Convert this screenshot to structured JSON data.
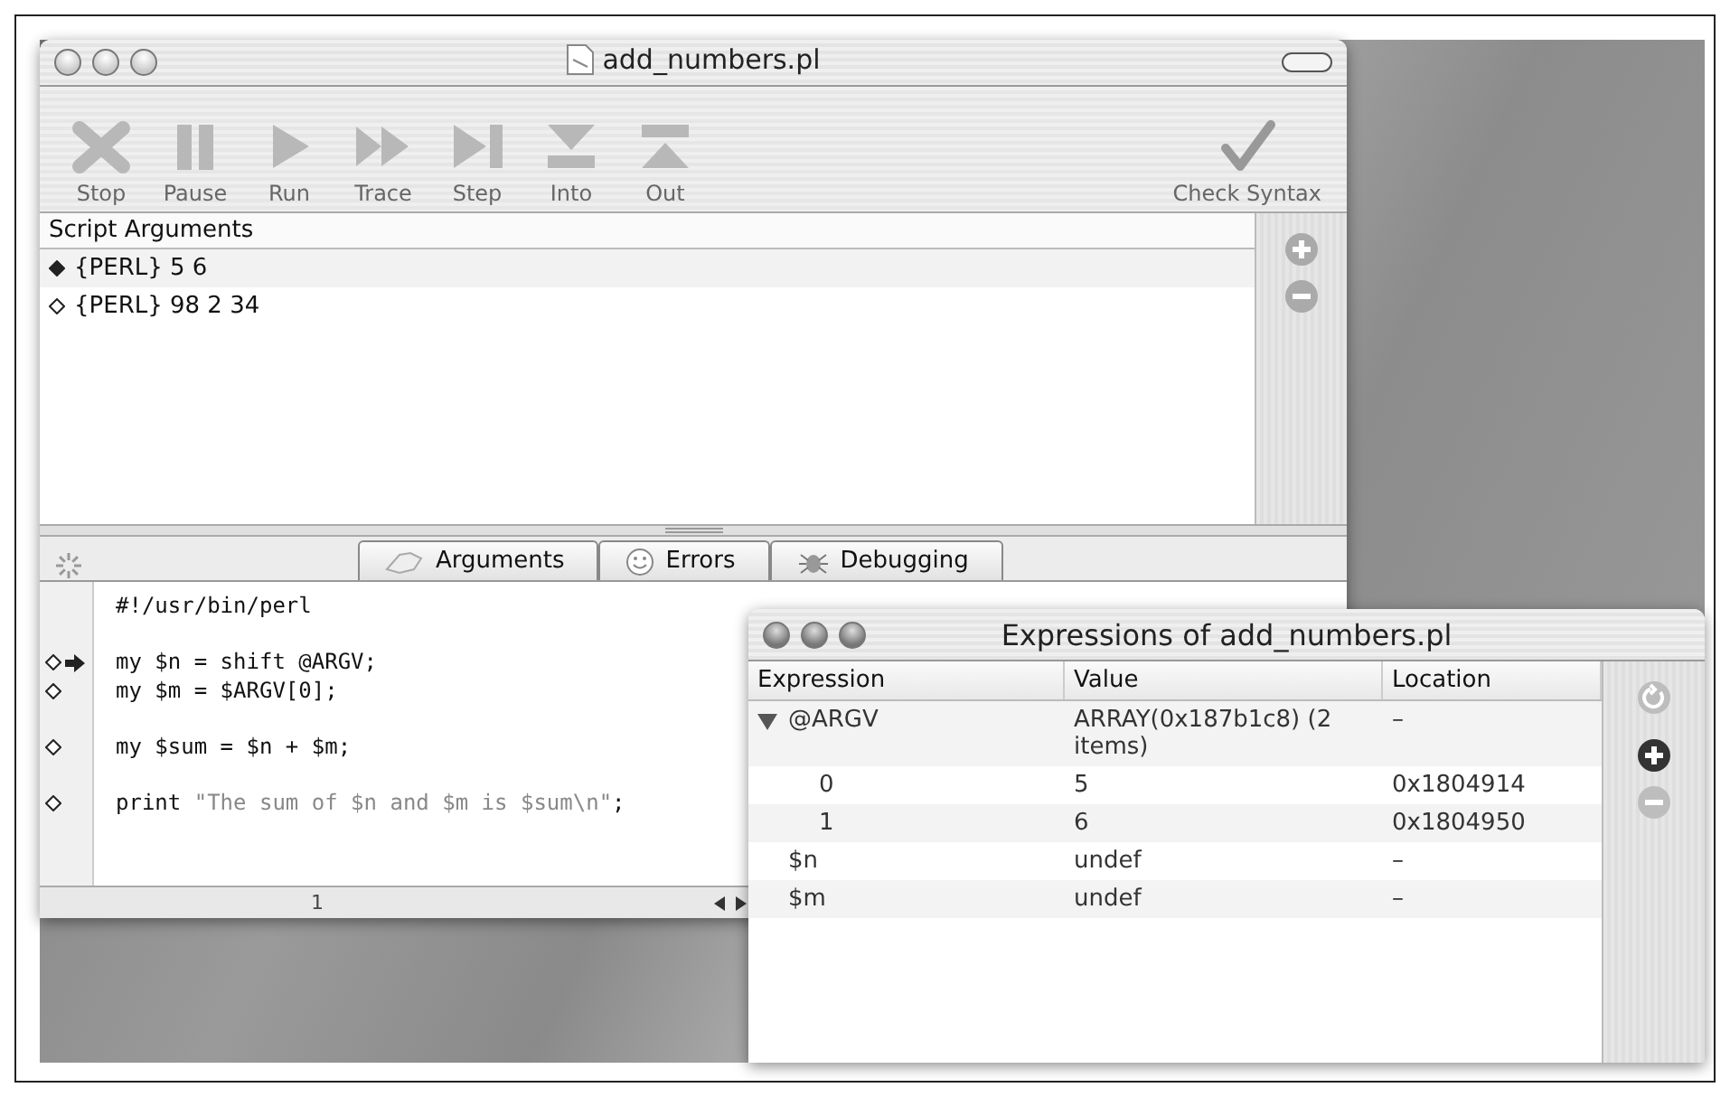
{
  "main_window": {
    "title": "add_numbers.pl",
    "toolbar": [
      {
        "label": "Stop",
        "kind": "stop"
      },
      {
        "label": "Pause",
        "kind": "pause"
      },
      {
        "label": "Run",
        "kind": "run"
      },
      {
        "label": "Trace",
        "kind": "trace"
      },
      {
        "label": "Step",
        "kind": "step"
      },
      {
        "label": "Into",
        "kind": "into"
      },
      {
        "label": "Out",
        "kind": "out"
      },
      {
        "label": "Check Syntax",
        "kind": "check"
      }
    ],
    "arguments": {
      "header": "Script Arguments",
      "items": [
        {
          "text": "{PERL} 5 6",
          "selected": true
        },
        {
          "text": "{PERL} 98 2 34",
          "selected": false
        }
      ]
    },
    "tabs": [
      {
        "label": "Arguments",
        "kind": "arguments"
      },
      {
        "label": "Errors",
        "kind": "errors"
      },
      {
        "label": "Debugging",
        "kind": "debugging"
      }
    ],
    "code_lines": [
      {
        "kind": "code",
        "marker": false,
        "current": false,
        "parts": [
          {
            "text": "#!/usr/bin/perl",
            "kind": "code"
          }
        ]
      },
      {
        "kind": "blank"
      },
      {
        "kind": "code",
        "marker": true,
        "current": true,
        "parts": [
          {
            "text": "my $n = shift @ARGV;",
            "kind": "code"
          }
        ]
      },
      {
        "kind": "code",
        "marker": true,
        "current": false,
        "parts": [
          {
            "text": "my $m = $ARGV[0];",
            "kind": "code"
          }
        ]
      },
      {
        "kind": "blank"
      },
      {
        "kind": "code",
        "marker": true,
        "current": false,
        "parts": [
          {
            "text": "my $sum = $n + $m;",
            "kind": "code"
          }
        ]
      },
      {
        "kind": "blank"
      },
      {
        "kind": "code",
        "marker": true,
        "current": false,
        "parts": [
          {
            "text": "print ",
            "kind": "code"
          },
          {
            "text": "\"The sum of $n and $m is $sum\\n\"",
            "kind": "string"
          },
          {
            "text": ";",
            "kind": "code"
          }
        ]
      }
    ],
    "status_line": "1"
  },
  "expressions_window": {
    "title": "Expressions of add_numbers.pl",
    "columns": [
      "Expression",
      "Value",
      "Location"
    ],
    "rows": [
      {
        "expression": "@ARGV",
        "value": "ARRAY(0x187b1c8) (2 items)",
        "location": "–",
        "expanded": true,
        "children": [
          {
            "expression": "0",
            "value": "5",
            "location": "0x1804914"
          },
          {
            "expression": "1",
            "value": "6",
            "location": "0x1804950"
          }
        ]
      },
      {
        "expression": "$n",
        "value": "undef",
        "location": "–"
      },
      {
        "expression": "$m",
        "value": "undef",
        "location": "–"
      }
    ],
    "buttons": [
      {
        "kind": "refresh",
        "disabled": true
      },
      {
        "kind": "add",
        "disabled": false
      },
      {
        "kind": "remove",
        "disabled": true
      }
    ]
  }
}
